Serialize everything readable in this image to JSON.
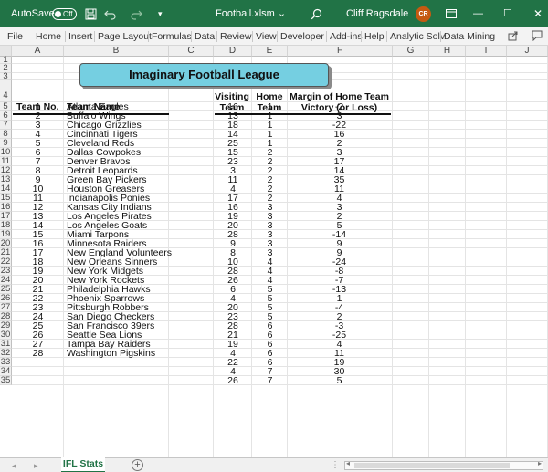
{
  "titlebar": {
    "autosave_label": "AutoSave",
    "autosave_state": "Off",
    "filename": "Football.xlsm",
    "filename_chevron": "⌄",
    "user_name": "Cliff Ragsdale",
    "user_initials": "CR",
    "save_icon": "save-icon",
    "undo_icon": "undo-icon",
    "redo_icon": "redo-icon",
    "search_icon": "search-icon",
    "min_icon": "—",
    "max_icon": "☐",
    "close_icon": "✕",
    "ribbon_icon": "ribbon-display-icon",
    "accent_color": "#217346"
  },
  "menu": {
    "file": "File",
    "home": "Home",
    "insert": "Insert",
    "page_layout": "Page Layout",
    "formulas": "Formulas",
    "data": "Data",
    "review": "Review",
    "view": "View",
    "developer": "Developer",
    "addins": "Add-ins",
    "help": "Help",
    "analytic": "Analytic Solv",
    "data_mining": "Data Mining",
    "share_icon": "share-icon",
    "comments_icon": "comments-icon"
  },
  "columns": [
    "A",
    "B",
    "C",
    "D",
    "E",
    "F",
    "G",
    "H",
    "I",
    "J"
  ],
  "row_numbers": [
    "1",
    "2",
    "3",
    "4",
    "5",
    "6",
    "7",
    "8",
    "9",
    "10",
    "11",
    "12",
    "13",
    "14",
    "15",
    "16",
    "17",
    "18",
    "19",
    "20",
    "21",
    "22",
    "23",
    "24",
    "25",
    "26",
    "27",
    "28",
    "29",
    "30",
    "31",
    "32",
    "33",
    "34",
    "35"
  ],
  "sheet": {
    "title": "Imaginary Football League",
    "headers": {
      "team_no": "Team No.",
      "team_name": "Team Name",
      "visiting_l1": "Visiting",
      "visiting_l2": "Team",
      "home_l1": "Home",
      "home_l2": "Team",
      "margin_l1": "Margin of Home Team",
      "margin_l2": "Victory (or Loss)"
    },
    "teams": [
      [
        "1",
        "Atlanta Eagles"
      ],
      [
        "2",
        "Buffalo Wings"
      ],
      [
        "3",
        "Chicago Grizzlies"
      ],
      [
        "4",
        "Cincinnati Tigers"
      ],
      [
        "5",
        "Cleveland Reds"
      ],
      [
        "6",
        "Dallas Cowpokes"
      ],
      [
        "7",
        "Denver Bravos"
      ],
      [
        "8",
        "Detroit Leopards"
      ],
      [
        "9",
        "Green Bay Pickers"
      ],
      [
        "10",
        "Houston Greasers"
      ],
      [
        "11",
        "Indianapolis Ponies"
      ],
      [
        "12",
        "Kansas City Indians"
      ],
      [
        "13",
        "Los Angeles Pirates"
      ],
      [
        "14",
        "Los Angeles Goats"
      ],
      [
        "15",
        "Miami Tarpons"
      ],
      [
        "16",
        "Minnesota Raiders"
      ],
      [
        "17",
        "New England Volunteers"
      ],
      [
        "18",
        "New Orleans Sinners"
      ],
      [
        "19",
        "New York Midgets"
      ],
      [
        "20",
        "New York Rockets"
      ],
      [
        "21",
        "Philadelphia Hawks"
      ],
      [
        "22",
        "Phoenix Sparrows"
      ],
      [
        "23",
        "Pittsburgh Robbers"
      ],
      [
        "24",
        "San Diego Checkers"
      ],
      [
        "25",
        "San Francisco 39ers"
      ],
      [
        "26",
        "Seattle Sea Lions"
      ],
      [
        "27",
        "Tampa Bay Raiders"
      ],
      [
        "28",
        "Washington Pigskins"
      ]
    ],
    "games": [
      [
        "16",
        "1",
        "-2"
      ],
      [
        "13",
        "1",
        "3"
      ],
      [
        "18",
        "1",
        "-22"
      ],
      [
        "14",
        "1",
        "16"
      ],
      [
        "25",
        "1",
        "2"
      ],
      [
        "15",
        "2",
        "3"
      ],
      [
        "23",
        "2",
        "17"
      ],
      [
        "3",
        "2",
        "14"
      ],
      [
        "11",
        "2",
        "35"
      ],
      [
        "4",
        "2",
        "11"
      ],
      [
        "17",
        "2",
        "4"
      ],
      [
        "16",
        "3",
        "3"
      ],
      [
        "19",
        "3",
        "2"
      ],
      [
        "20",
        "3",
        "5"
      ],
      [
        "28",
        "3",
        "-14"
      ],
      [
        "9",
        "3",
        "9"
      ],
      [
        "8",
        "3",
        "9"
      ],
      [
        "10",
        "4",
        "-24"
      ],
      [
        "28",
        "4",
        "-8"
      ],
      [
        "26",
        "4",
        "-7"
      ],
      [
        "6",
        "5",
        "-13"
      ],
      [
        "4",
        "5",
        "1"
      ],
      [
        "20",
        "5",
        "-4"
      ],
      [
        "23",
        "5",
        "2"
      ],
      [
        "28",
        "6",
        "-3"
      ],
      [
        "21",
        "6",
        "-25"
      ],
      [
        "19",
        "6",
        "4"
      ],
      [
        "4",
        "6",
        "11"
      ],
      [
        "22",
        "6",
        "19"
      ],
      [
        "4",
        "7",
        "30"
      ],
      [
        "26",
        "7",
        "5"
      ]
    ]
  },
  "tabs": {
    "sheet_name": "IFL Stats",
    "add_label": "+",
    "prev_icon": "◂",
    "next_icon": "▸",
    "more_icon": "⋮",
    "scroll_left_icon": "◂",
    "scroll_right_icon": "▸"
  }
}
